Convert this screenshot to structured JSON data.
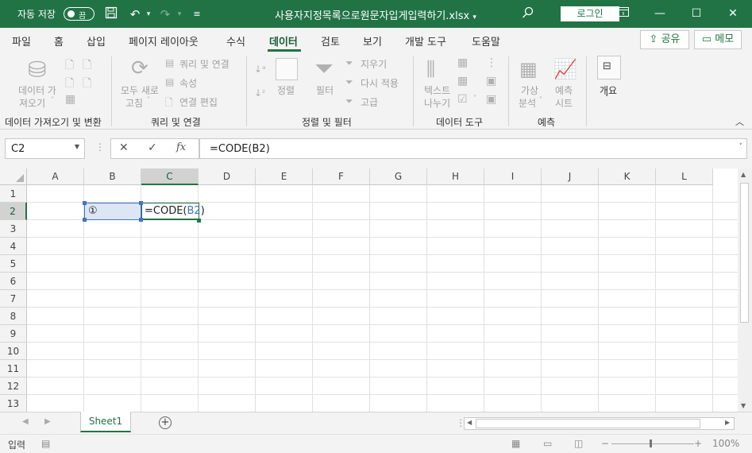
{
  "titlebar": {
    "autosave_label": "자동 저장",
    "autosave_state": "끔",
    "title": "사용자지정목록으로원문자입게입력하기.xlsx",
    "login_label": "로그인"
  },
  "tabs": [
    "파일",
    "홈",
    "삽입",
    "페이지 레이아웃",
    "수식",
    "데이터",
    "검토",
    "보기",
    "개발 도구",
    "도움말"
  ],
  "active_tab": "데이터",
  "share_label": "공유",
  "memo_label": "메모",
  "ribbon": {
    "get_data": {
      "line1": "데이터 가",
      "line2": "져오기"
    },
    "refresh_all": {
      "line1": "모두 새로",
      "line2": "고침"
    },
    "queries_connections": "쿼리 및 연결",
    "properties": "속성",
    "edit_links": "연결 편집",
    "sort": "정렬",
    "filter": "필터",
    "clear": "지우기",
    "reapply": "다시 적용",
    "advanced": "고급",
    "text_to_columns": {
      "line1": "텍스트",
      "line2": "나누기"
    },
    "what_if": {
      "line1": "가상",
      "line2": "분석"
    },
    "forecast_sheet": {
      "line1": "예측",
      "line2": "시트"
    },
    "outline": "개요",
    "groups": {
      "get_transform": "데이터 가져오기 및 변환",
      "queries": "쿼리 및 연결",
      "sort_filter": "정렬 및 필터",
      "data_tools": "데이터 도구",
      "forecast": "예측"
    }
  },
  "formula_bar": {
    "name_box": "C2",
    "fx": "fx",
    "formula": "=CODE(B2)"
  },
  "columns": [
    "A",
    "B",
    "C",
    "D",
    "E",
    "F",
    "G",
    "H",
    "I",
    "J",
    "K",
    "L"
  ],
  "rows": [
    "1",
    "2",
    "3",
    "4",
    "5",
    "6",
    "7",
    "8",
    "9",
    "10",
    "11",
    "12",
    "13"
  ],
  "cells": {
    "B2": "①",
    "C2_prefix": "=CODE(",
    "C2_ref": "B2",
    "C2_suffix": ")"
  },
  "sheet_tab": "Sheet1",
  "status": {
    "mode": "입력",
    "zoom": "100%"
  }
}
